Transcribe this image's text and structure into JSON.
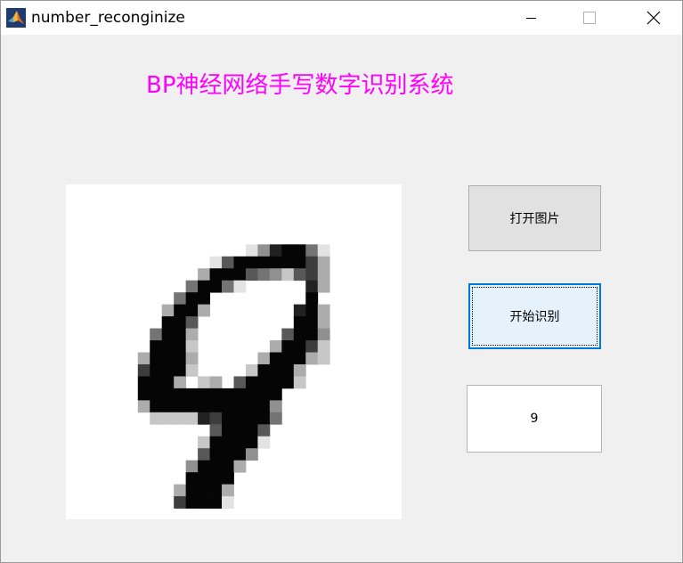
{
  "window": {
    "title": "number_reconginize",
    "icon": "matlab-icon",
    "controls": [
      "minimize-icon",
      "maximize-icon",
      "close-icon"
    ]
  },
  "heading": {
    "text": "BP神经网络手写数字识别系统",
    "color": "#ff00ff"
  },
  "image_panel": {
    "content": "handwritten-digit-image"
  },
  "buttons": {
    "open_image": "打开图片",
    "start_recognition": "开始识别"
  },
  "result": {
    "value": "9"
  },
  "colors": {
    "focus_border": "#0078d7",
    "focus_fill": "#e5f1fb",
    "button_fill": "#e1e1e1",
    "background": "#f0f0f0"
  }
}
